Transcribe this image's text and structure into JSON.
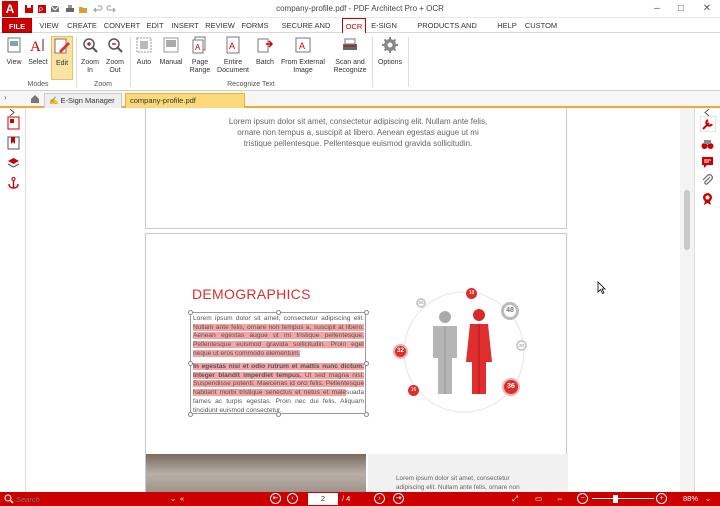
{
  "window": {
    "title": "company-profile.pdf  -  PDF Architect Pro + OCR",
    "logo": "A"
  },
  "menu": [
    "FILE",
    "VIEW",
    "CREATE",
    "CONVERT",
    "EDIT",
    "INSERT",
    "REVIEW",
    "FORMS",
    "SECURE AND SIGN",
    "OCR",
    "E-SIGN",
    "PRODUCTS AND PRICING",
    "HELP",
    "CUSTOM"
  ],
  "ribbon": {
    "buttons": [
      {
        "label": "View",
        "icon": "view-icon"
      },
      {
        "label": "Select",
        "icon": "select-text-icon"
      },
      {
        "label": "Edit",
        "icon": "edit-icon"
      },
      {
        "label": "Zoom\nIn",
        "icon": "zoom-in-icon"
      },
      {
        "label": "Zoom\nOut",
        "icon": "zoom-out-icon"
      },
      {
        "label": "Auto",
        "icon": "auto-ocr-icon"
      },
      {
        "label": "Manual",
        "icon": "manual-ocr-icon"
      },
      {
        "label": "Page\nRange",
        "icon": "page-range-icon"
      },
      {
        "label": "Entire\nDocument",
        "icon": "entire-document-icon"
      },
      {
        "label": "Batch",
        "icon": "batch-icon"
      },
      {
        "label": "From External\nImage",
        "icon": "external-image-icon"
      },
      {
        "label": "Scan and\nRecognize",
        "icon": "scanner-icon"
      },
      {
        "label": "Options",
        "icon": "gear-icon"
      }
    ],
    "groups": {
      "modes": "Modes",
      "zoom": "Zoom",
      "recognize": "Recognize Text"
    }
  },
  "tabs": {
    "esign": "E-Sign Manager",
    "document": "company-profile.pdf"
  },
  "page1": {
    "text": "Lorem ipsum dolor sit amet, consectetur adipiscing elit. Nullam ante felis, ornare non tempus a, suscipit at libero. Aenean egestas augue ut mi tristique pellentesque. Pellentesque euismod gravida sollicitudin."
  },
  "page2": {
    "title": "DEMOGRAPHICS",
    "para1_plain": "Lorem ipsum dolor sit amet, consectetur adipiscing elit. ",
    "para1_highlight": "Nullam ante felis, ornare non tempus a, suscipit at libero. Aenean egestas augue ut mi tristique pellentesque. Pellentesque euismod gravida sollicitudin. Proin eget neque ut eros commodo elementum.",
    "para2_bold": "In egestas nisi et odio rutrum et mattis nunc dictum. Integer blandit imperdiet tempus.",
    "para2_highlight": " Ut sed magna nisl. Suspendisse potenti. Maecenas id orci felis. Pellentesque habitant morbi tristique senectus et netus et male",
    "para2_plain": "suada fames ac turpis egestas. Proin nec dui felis. Aliquam tincidunt euismod consectetur.",
    "stats": [
      "18",
      "48",
      "20",
      "36",
      "16",
      "32",
      "56"
    ],
    "bottom_text": "Lorem ipsum dolor sit amet, consectetur adipiscing elit. Nullam ante felis, ornare non tempus a, suscipit at libero."
  },
  "status": {
    "search_placeholder": "Search",
    "page_current": "2",
    "page_total": "/ 4",
    "zoom": "88%"
  },
  "colors": {
    "brand": "#cc0000",
    "highlight": "#f5a3a3",
    "accent": "#f0a830"
  }
}
